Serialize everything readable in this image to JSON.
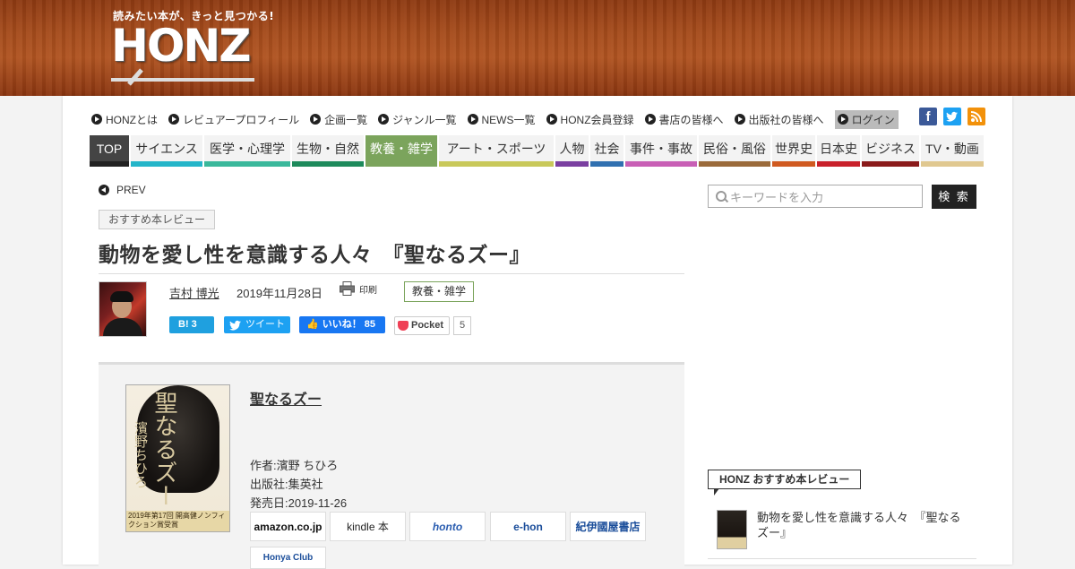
{
  "header": {
    "tagline": "読みたい本が、きっと見つかる!",
    "logo_text": "HONZ"
  },
  "topnav": [
    {
      "label": "HONZとは"
    },
    {
      "label": "レビュアープロフィール"
    },
    {
      "label": "企画一覧"
    },
    {
      "label": "ジャンル一覧"
    },
    {
      "label": "NEWS一覧"
    },
    {
      "label": "HONZ会員登録"
    },
    {
      "label": "書店の皆様へ"
    },
    {
      "label": "出版社の皆様へ"
    },
    {
      "label": "ログイン"
    }
  ],
  "social": [
    {
      "label": "f",
      "color": "#3b5998"
    },
    {
      "label": "t",
      "color": "#1da1f2"
    },
    {
      "label": "rss",
      "color": "#f2910a"
    }
  ],
  "categories": [
    {
      "label": "TOP",
      "color": "#222222"
    },
    {
      "label": "サイエンス",
      "color": "#24b5c9"
    },
    {
      "label": "医学・心理学",
      "color": "#3ab89b"
    },
    {
      "label": "生物・自然",
      "color": "#1d8a5b"
    },
    {
      "label": "教養・雑学",
      "color": "#7ba45c"
    },
    {
      "label": "アート・スポーツ",
      "color": "#c8c85a"
    },
    {
      "label": "人物",
      "color": "#7a3fa0"
    },
    {
      "label": "社会",
      "color": "#3070b0"
    },
    {
      "label": "事件・事故",
      "color": "#c85fb5"
    },
    {
      "label": "民俗・風俗",
      "color": "#9a6a3a"
    },
    {
      "label": "世界史",
      "color": "#d05a20"
    },
    {
      "label": "日本史",
      "color": "#c8202a"
    },
    {
      "label": "ビジネス",
      "color": "#8a1a1a"
    },
    {
      "label": "TV・動画",
      "color": "#e0c890"
    }
  ],
  "article": {
    "prev": "PREV",
    "tag": "おすすめ本レビュー",
    "title": "動物を愛し性を意識する人々　『聖なるズー』",
    "author": "吉村 博光",
    "date": "2019年11月28日",
    "print": "印刷",
    "category": "教養・雑学",
    "share": {
      "hatena": "B! 3",
      "tweet": "ツイート",
      "fb_like": "いいね！ 85",
      "pocket": "Pocket",
      "pocket_count": "5"
    }
  },
  "book": {
    "title": "聖なるズー",
    "author": "作者:濱野 ちひろ",
    "publisher": "出版社:集英社",
    "release": "発売日:2019-11-26",
    "cover_title": "聖なるズー",
    "cover_author": "濱野ちひろ",
    "cover_band": "2019年第17回 開高健ノンフィクション賞受賞",
    "shops": [
      "amazon.co.jp",
      "kindle 本",
      "honto",
      "e-hon",
      "紀伊國屋書店",
      "Honya Club"
    ]
  },
  "sidebar": {
    "search_placeholder": "キーワードを入力",
    "search_button": "検 索",
    "section_title": "HONZ おすすめ本レビュー",
    "item_text": "動物を愛し性を意識する人々　『聖なるズー』"
  }
}
